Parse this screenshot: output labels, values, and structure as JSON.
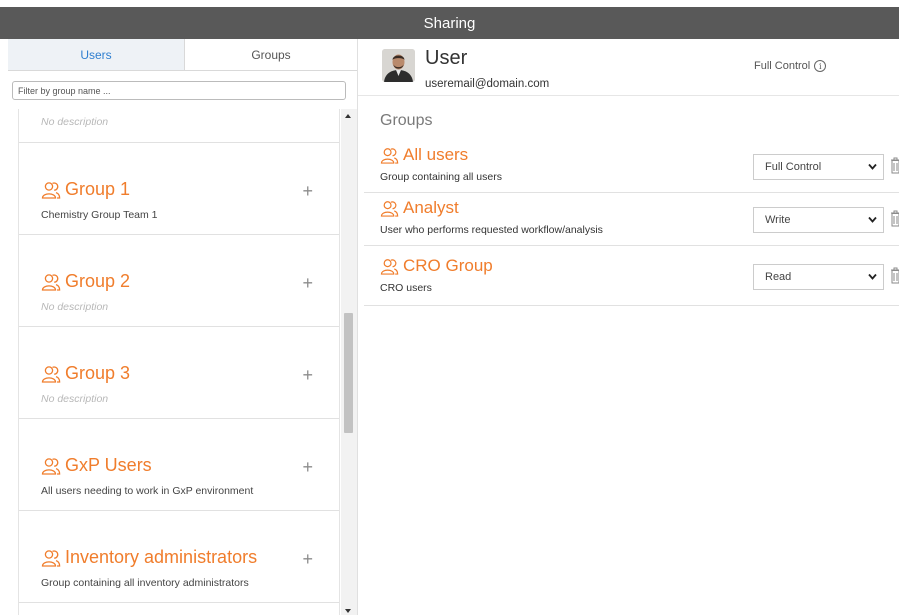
{
  "window": {
    "title": "Sharing"
  },
  "tabs": [
    {
      "label": "Users",
      "active": true
    },
    {
      "label": "Groups",
      "active": false
    }
  ],
  "filter": {
    "placeholder": "Filter by group name ...",
    "value": ""
  },
  "group_list": {
    "partial_top": {
      "name": "",
      "description": "No description"
    },
    "items": [
      {
        "name": "Group 1",
        "description": "Chemistry Group Team 1",
        "has_description": true
      },
      {
        "name": "Group 2",
        "description": "No description",
        "has_description": false
      },
      {
        "name": "Group 3",
        "description": "No description",
        "has_description": false
      },
      {
        "name": "GxP Users",
        "description": "All users needing to work in GxP environment",
        "has_description": true
      },
      {
        "name": "Inventory administrators",
        "description": "Group containing all inventory administrators",
        "has_description": true
      }
    ],
    "add_symbol": "+"
  },
  "user": {
    "name": "User",
    "email": "useremail@domain.com",
    "permission": "Full Control",
    "info_symbol": "i"
  },
  "groups_section": {
    "title": "Groups",
    "rows": [
      {
        "name": "All users",
        "description": "Group containing all users",
        "permission": "Full Control"
      },
      {
        "name": "Analyst",
        "description": "User who performs requested workflow/analysis",
        "permission": "Write"
      },
      {
        "name": "CRO Group",
        "description": "CRO users",
        "permission": "Read"
      }
    ]
  },
  "colors": {
    "accent_orange": "#f07d2c",
    "titlebar": "#595959",
    "active_tab_text": "#2f7fd0"
  },
  "icons": {
    "group": "user-group-icon",
    "add": "plus-icon",
    "info": "info-icon",
    "dropdown": "chevron-down-icon",
    "delete": "trash-icon",
    "scroll_up": "scroll-up-arrow-icon",
    "scroll_down": "scroll-down-arrow-icon"
  }
}
